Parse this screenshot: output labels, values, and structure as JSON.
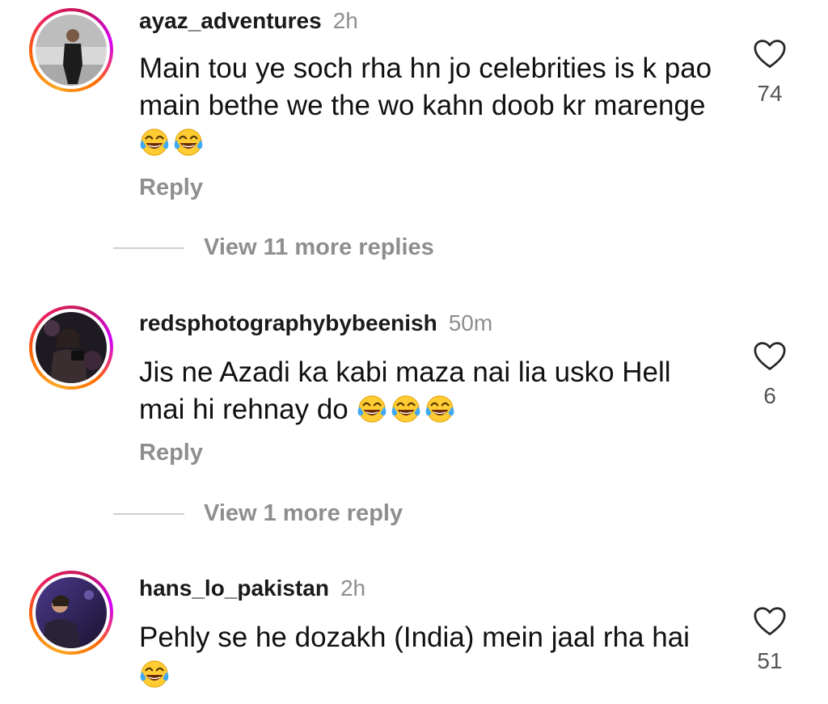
{
  "comments": [
    {
      "username": "ayaz_adventures",
      "time": "2h",
      "text": "Main tou ye soch rha hn jo celebrities is k pao main bethe we the wo kahn doob kr marenge",
      "emoji_count": 2,
      "likes": "74",
      "reply_label": "Reply",
      "view_replies": "View 11 more replies"
    },
    {
      "username": "redsphotographybybeenish",
      "time": "50m",
      "text": "Jis ne Azadi ka kabi maza nai lia usko Hell mai hi rehnay do",
      "emoji_count": 3,
      "likes": "6",
      "reply_label": "Reply",
      "view_replies": "View 1 more reply"
    },
    {
      "username": "hans_lo_pakistan",
      "time": "2h",
      "text": "Pehly se he dozakh (India) mein jaal rha hai",
      "emoji_count": 1,
      "likes": "51"
    }
  ],
  "icons": {
    "like": "heart-outline-icon",
    "emoji": "face-with-tears-of-joy-emoji"
  },
  "colors": {
    "username": "#1a1a1a",
    "secondary": "#8e8e8e",
    "text": "#111111",
    "story_ring_start": "#f9a825",
    "story_ring_end": "#d500f9"
  }
}
